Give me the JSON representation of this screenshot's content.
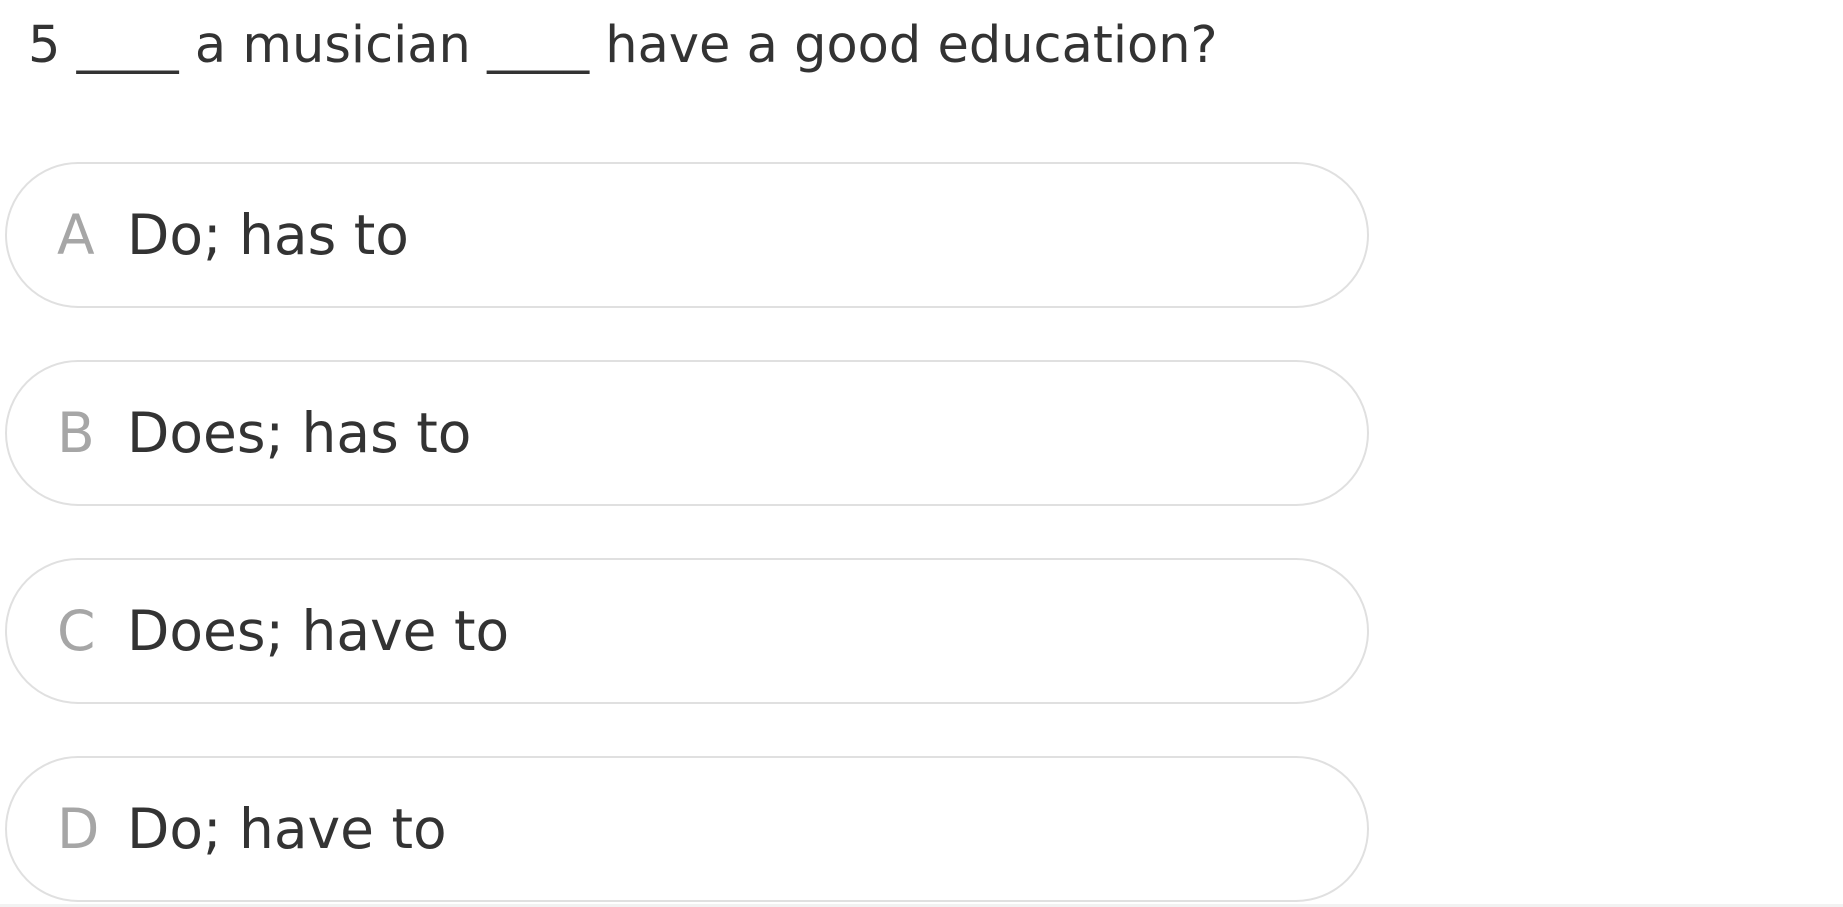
{
  "question": {
    "text": "5 ____ a musician ____ have a good education?"
  },
  "options": [
    {
      "letter": "A",
      "text": "Do; has to"
    },
    {
      "letter": "B",
      "text": "Does; has to"
    },
    {
      "letter": "C",
      "text": "Does; have to"
    },
    {
      "letter": "D",
      "text": "Do; have to"
    }
  ],
  "colors": {
    "text": "#333333",
    "letter": "#a6a6a6",
    "border": "#e0e0e0",
    "background": "#ffffff"
  }
}
